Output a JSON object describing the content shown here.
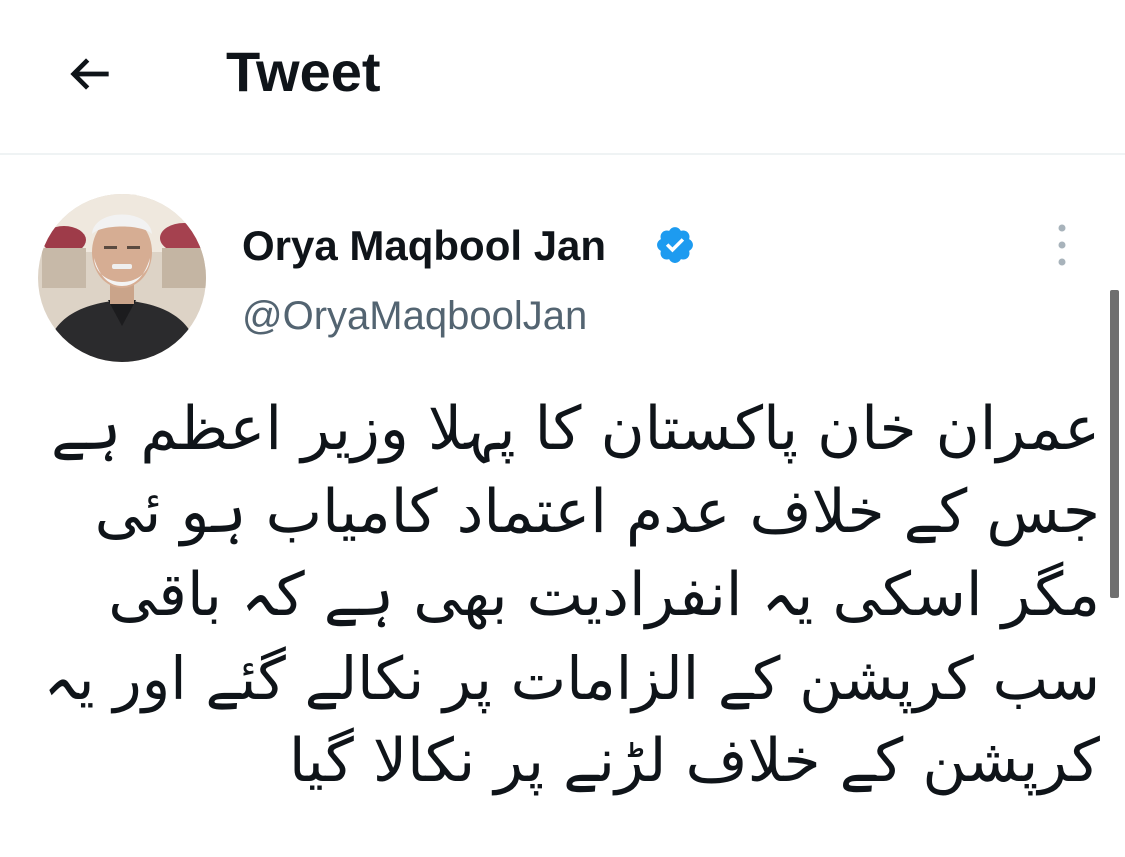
{
  "header": {
    "title": "Tweet",
    "back_icon": "arrow-left-icon"
  },
  "tweet": {
    "author_name": "Orya Maqbool Jan",
    "handle": "@OryaMaqboolJan",
    "verified_icon": "verified-badge-icon",
    "verified_color": "#1d9bf0",
    "more_icon": "more-vertical-icon",
    "text_lines": [
      "عمران خان پاکستان کا پہلا وزیر اعظم ہے",
      "جس کے خلاف عدم اعتماد کامیاب ہو ئی",
      "مگر اسکی یہ انفرادیت بھی ہے کہ باقی",
      "سب کرپشن کے الزامات پر نکالے گئے اور یہ",
      "کرپشن کے خلاف لڑنے پر نکالا گیا"
    ]
  },
  "colors": {
    "text_primary": "#0f1419",
    "text_secondary": "#536471",
    "divider": "#eff3f4",
    "accent": "#1d9bf0"
  }
}
